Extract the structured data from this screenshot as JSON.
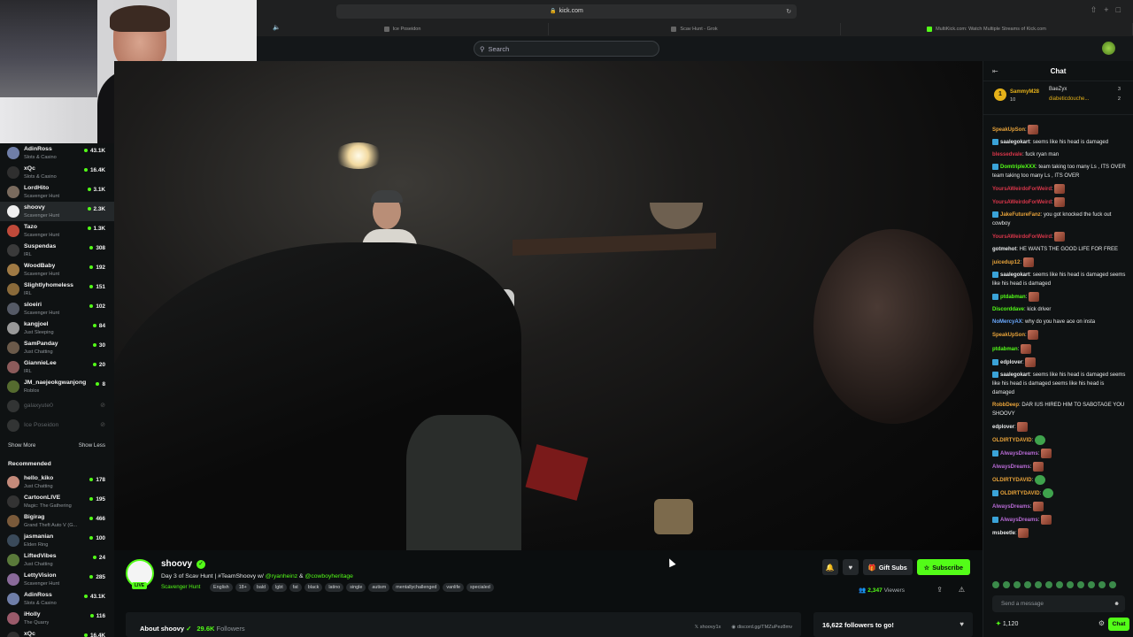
{
  "browser": {
    "url": "kick.com",
    "tabs": [
      "Ice Poseidon",
      "Scav Hunt - Grok",
      "MultiKick.com: Watch Multiple Streams of Kick.com"
    ]
  },
  "topbar": {
    "search_placeholder": "Search"
  },
  "sidebar": {
    "following": [
      {
        "name": "AdinRoss",
        "category": "Slots & Casino",
        "viewers": "43.1K",
        "color": "#6f7ea8"
      },
      {
        "name": "xQc",
        "category": "Slots & Casino",
        "viewers": "16.4K",
        "color": "#2f2f2f"
      },
      {
        "name": "LordHito",
        "category": "Scavenger Hunt",
        "viewers": "3.1K",
        "color": "#7a6b5e"
      },
      {
        "name": "shoovy",
        "category": "Scavenger Hunt",
        "viewers": "2.3K",
        "color": "#f0f0f0"
      },
      {
        "name": "Tazo",
        "category": "Scavenger Hunt",
        "viewers": "1.3K",
        "color": "#c04a3a"
      },
      {
        "name": "Suspendas",
        "category": "IRL",
        "viewers": "308",
        "color": "#3a3a3a"
      },
      {
        "name": "WoodBaby",
        "category": "Scavenger Hunt",
        "viewers": "192",
        "color": "#a07a44"
      },
      {
        "name": "Slightlyhomeless",
        "category": "IRL",
        "viewers": "151",
        "color": "#8a6a3a"
      },
      {
        "name": "sloeiri",
        "category": "Scavenger Hunt",
        "viewers": "102",
        "color": "#555a66"
      },
      {
        "name": "kangjoel",
        "category": "Just Sleeping",
        "viewers": "84",
        "color": "#999"
      },
      {
        "name": "SamPanday",
        "category": "Just Chatting",
        "viewers": "30",
        "color": "#6b5a4a"
      },
      {
        "name": "GiannieLee",
        "category": "IRL",
        "viewers": "20",
        "color": "#8c5b5b"
      },
      {
        "name": "JM_naejeokgwanjong",
        "category": "Roblox",
        "viewers": "8",
        "color": "#556b2f"
      }
    ],
    "offline": [
      "galaxyute0",
      "Ice Poseidon"
    ],
    "show_more": "Show More",
    "show_less": "Show Less",
    "recommended_title": "Recommended",
    "recommended": [
      {
        "name": "hello_kiko",
        "category": "Just Chatting",
        "viewers": "178",
        "color": "#c48a7a"
      },
      {
        "name": "CartoonLIVE",
        "category": "Magic: The Gathering",
        "viewers": "195",
        "color": "#333"
      },
      {
        "name": "Bigirag",
        "category": "Grand Theft Auto V (G...",
        "viewers": "466",
        "color": "#7a5a3a"
      },
      {
        "name": "jasmanian",
        "category": "Elden Ring",
        "viewers": "100",
        "color": "#3a4a5a"
      },
      {
        "name": "LiftedVibes",
        "category": "Just Chatting",
        "viewers": "24",
        "color": "#5a7a3a"
      },
      {
        "name": "LettyVision",
        "category": "Scavenger Hunt",
        "viewers": "285",
        "color": "#8a6a9a"
      },
      {
        "name": "AdinRoss",
        "category": "Slots & Casino",
        "viewers": "43.1K",
        "color": "#6f7ea8"
      },
      {
        "name": "iHolly",
        "category": "The Quarry",
        "viewers": "116",
        "color": "#9a5a6a"
      },
      {
        "name": "xQc",
        "category": "",
        "viewers": "16.4K",
        "color": "#2f2f2f"
      }
    ]
  },
  "stream": {
    "channel": "shoovy",
    "live_label": "LIVE",
    "title_prefix": "Day 3 of Scav Hunt | #TeamShoovy w/ ",
    "mention1": "@ryanheinz",
    "title_amp": " & ",
    "mention2": "@cowboyheritage",
    "category": "Scavenger Hunt",
    "tags": [
      "English",
      "18+",
      "bald",
      "lgbt",
      "fat",
      "black",
      "latino",
      "single",
      "autism",
      "mentallychallenged",
      "vanlife",
      "specialed"
    ],
    "gift_label": "Gift Subs",
    "subscribe_label": "Subscribe",
    "viewers": "2,347",
    "viewers_label": "Viewers",
    "about_label": "About shoovy",
    "followers": "29.6K",
    "followers_label": "Followers",
    "social1": "shoovy1x",
    "social2": "discord.gg/TMZuPez8mv",
    "goal": "16,622 followers to go!"
  },
  "chat": {
    "title": "Chat",
    "pinned": [
      {
        "name": "SammyM28",
        "count": "10"
      },
      {
        "name": "BaeZyx",
        "count": "3"
      },
      {
        "name": "diabeticdouche...",
        "count": "2"
      }
    ],
    "messages": [
      {
        "user": "SpeakUpSon",
        "color": "#e8a33a",
        "text": ""
      },
      {
        "user": "saalegokart",
        "color": "#e7e9ea",
        "text": "seems like his head is damaged"
      },
      {
        "user": "blessedvale",
        "color": "#d9364a",
        "text": "fuck ryan man"
      },
      {
        "user": "DomtripleXXX",
        "color": "#53fc18",
        "text": "team taking too many Ls , ITS OVER team taking too many Ls , ITS OVER"
      },
      {
        "user": "YoursAWeirdoForWeird",
        "color": "#d9364a",
        "text": ""
      },
      {
        "user": "YoursAWeirdoForWeird",
        "color": "#d9364a",
        "text": ""
      },
      {
        "user": "JakeFutureFanz",
        "color": "#e8a33a",
        "text": "you got knocked the fuck out cowboy"
      },
      {
        "user": "YoursAWeirdoForWeird",
        "color": "#d9364a",
        "text": ""
      },
      {
        "user": "gotmehot",
        "color": "#e7e9ea",
        "text": "HE WANTS THE GOOD LIFE FOR FREE"
      },
      {
        "user": "juicedup12",
        "color": "#e8a33a",
        "text": ""
      },
      {
        "user": "saalegokart",
        "color": "#e7e9ea",
        "text": "seems like his head is damaged seems like his head is damaged"
      },
      {
        "user": "ptdabman",
        "color": "#53fc18",
        "text": ""
      },
      {
        "user": "Discorddave",
        "color": "#53fc18",
        "text": "kick driver"
      },
      {
        "user": "NoMercyAX",
        "color": "#6aa9ff",
        "text": "why do you have ace on insta"
      },
      {
        "user": "SpeakUpSon",
        "color": "#e8a33a",
        "text": ""
      },
      {
        "user": "ptdabman",
        "color": "#53fc18",
        "text": ""
      },
      {
        "user": "edplover",
        "color": "#e7e9ea",
        "text": ""
      },
      {
        "user": "saalegokart",
        "color": "#e7e9ea",
        "text": "seems like his head is damaged seems like his head is damaged seems like his head is damaged"
      },
      {
        "user": "RobbDeep",
        "color": "#e8a33a",
        "text": "DAR IUS HIRED HIM TO SABOTAGE YOU SHOOVY"
      },
      {
        "user": "edplover",
        "color": "#e7e9ea",
        "text": ""
      },
      {
        "user": "OLDIRTYDAVID",
        "color": "#e8a33a",
        "text": ""
      },
      {
        "user": "AlwaysDreams",
        "color": "#b86bd6",
        "text": ""
      },
      {
        "user": "AlwaysDreams",
        "color": "#b86bd6",
        "text": ""
      },
      {
        "user": "OLDIRTYDAVID",
        "color": "#e8a33a",
        "text": ""
      },
      {
        "user": "OLDIRTYDAVID",
        "color": "#e8a33a",
        "text": ""
      },
      {
        "user": "AlwaysDreams",
        "color": "#b86bd6",
        "text": ""
      },
      {
        "user": "AlwaysDreams",
        "color": "#b86bd6",
        "text": ""
      },
      {
        "user": "msbeetle",
        "color": "#e7e9ea",
        "text": ""
      }
    ],
    "input_placeholder": "Send a message",
    "points": "1,120",
    "chat_button": "Chat"
  },
  "colors": {
    "accent": "#53fc18",
    "background": "#0b0e0f"
  }
}
